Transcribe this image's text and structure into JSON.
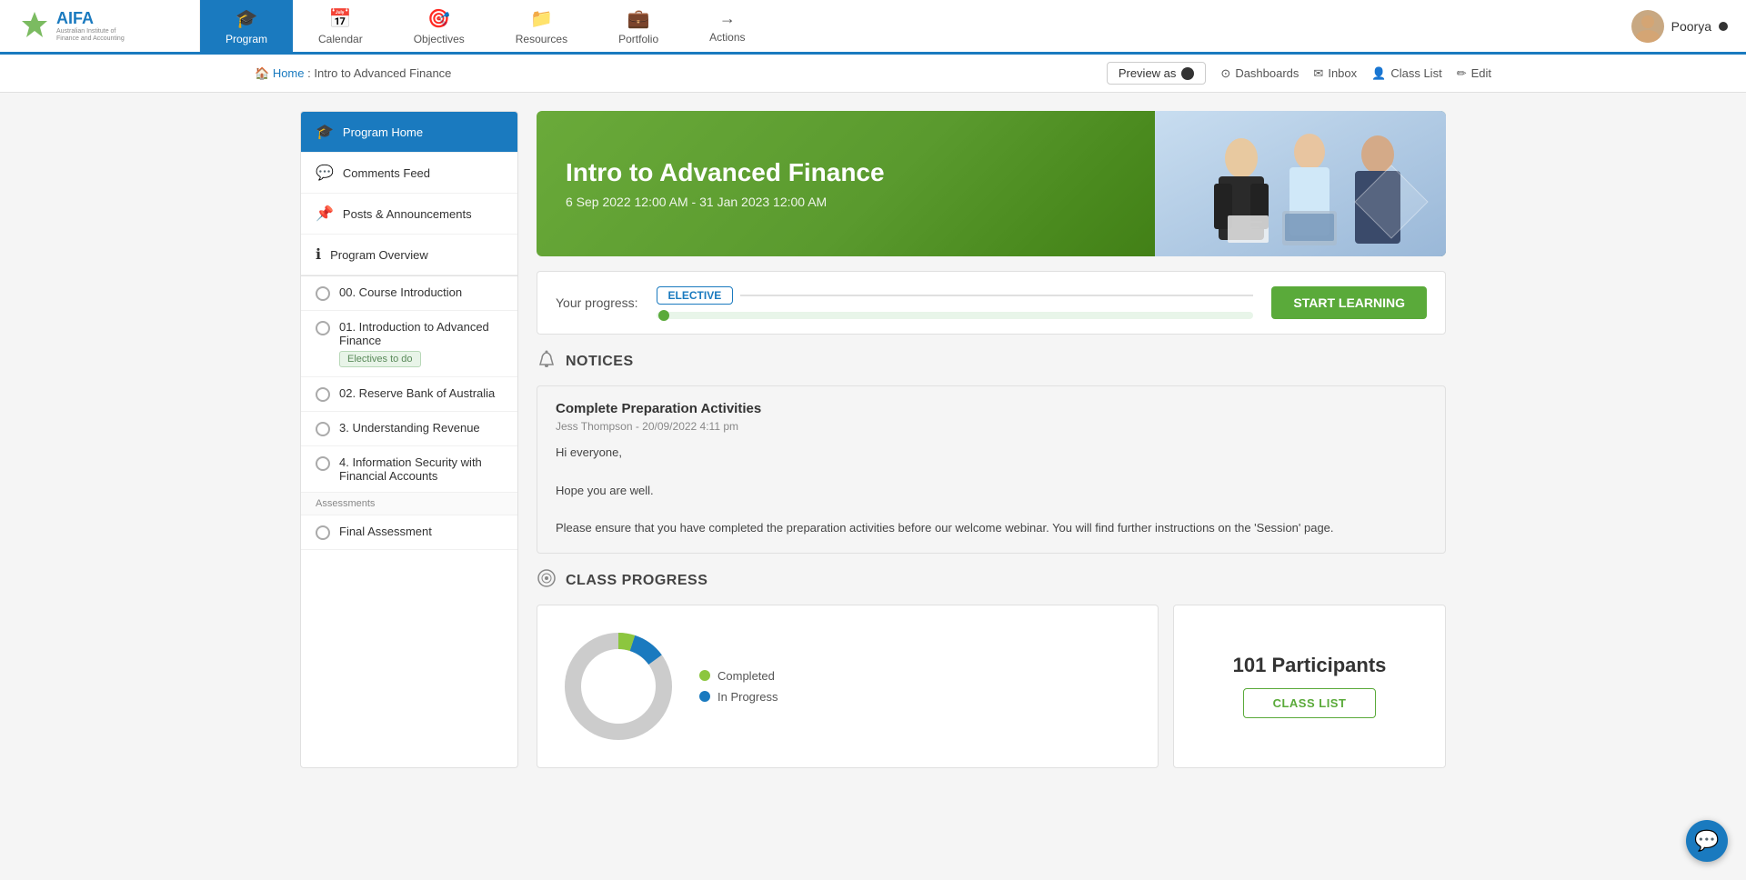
{
  "logo": {
    "abbr": "AIFA",
    "full": "Australian Institute of Finance and Accounting"
  },
  "nav": {
    "items": [
      {
        "id": "program",
        "label": "Program",
        "icon": "🎓",
        "active": true
      },
      {
        "id": "calendar",
        "label": "Calendar",
        "icon": "📅",
        "active": false
      },
      {
        "id": "objectives",
        "label": "Objectives",
        "icon": "🎯",
        "active": false
      },
      {
        "id": "resources",
        "label": "Resources",
        "icon": "📁",
        "active": false
      },
      {
        "id": "portfolio",
        "label": "Portfolio",
        "icon": "💼",
        "active": false
      },
      {
        "id": "actions",
        "label": "Actions",
        "icon": "→",
        "active": false
      }
    ]
  },
  "user": {
    "name": "Poorya",
    "dot": true
  },
  "breadcrumb": {
    "home_label": "Home",
    "separator": " : ",
    "current": "Intro to Advanced Finance"
  },
  "toolbar": {
    "preview_as": "Preview as",
    "dashboards": "Dashboards",
    "inbox": "Inbox",
    "class_list": "Class List",
    "edit": "Edit"
  },
  "sidebar": {
    "items": [
      {
        "id": "program-home",
        "label": "Program Home",
        "icon": "🎓",
        "active": true
      },
      {
        "id": "comments-feed",
        "label": "Comments Feed",
        "icon": "💬",
        "active": false
      },
      {
        "id": "posts-announcements",
        "label": "Posts & Announcements",
        "icon": "📌",
        "active": false
      },
      {
        "id": "program-overview",
        "label": "Program Overview",
        "icon": "ℹ",
        "active": false
      }
    ],
    "modules": [
      {
        "id": "module-00",
        "label": "00. Course Introduction",
        "has_radio": true
      },
      {
        "id": "module-01",
        "label": "01. Introduction to Advanced Finance",
        "has_radio": true,
        "badge": "Electives to do"
      },
      {
        "id": "module-02",
        "label": "02. Reserve Bank of Australia",
        "has_radio": true
      },
      {
        "id": "module-03",
        "label": "3. Understanding Revenue",
        "has_radio": true
      },
      {
        "id": "module-04",
        "label": "4. Information Security with Financial Accounts",
        "has_radio": true
      }
    ],
    "assessments_label": "Assessments",
    "assessment_items": [
      {
        "id": "final-assessment",
        "label": "Final Assessment",
        "has_radio": true
      }
    ]
  },
  "hero": {
    "title": "Intro to Advanced Finance",
    "dates": "6 Sep 2022 12:00 AM - 31 Jan 2023 12:00 AM"
  },
  "progress": {
    "label": "Your progress:",
    "elective_badge": "ELECTIVE",
    "start_btn": "START LEARNING"
  },
  "notices": {
    "section_title": "NOTICES",
    "items": [
      {
        "id": "notice-1",
        "title": "Complete Preparation Activities",
        "meta": "Jess Thompson - 20/09/2022 4:11 pm",
        "greeting": "Hi everyone,",
        "body1": "Hope you are well.",
        "body2": "Please ensure that you have completed the preparation activities before our welcome webinar. You will find further instructions on the 'Session' page."
      }
    ]
  },
  "class_progress": {
    "section_title": "CLASS PROGRESS",
    "donut": {
      "completed_pct": 5,
      "in_progress_pct": 10,
      "not_started_pct": 85,
      "colors": {
        "completed": "#8cc63f",
        "in_progress": "#1a7abf",
        "not_started": "#cccccc"
      }
    },
    "legend": [
      {
        "label": "Completed",
        "color": "#8cc63f"
      },
      {
        "label": "In Progress",
        "color": "#1a7abf"
      }
    ],
    "participants": {
      "count": "101 Participants",
      "btn_label": "CLASS LIST"
    }
  },
  "chat_icon": "💬"
}
